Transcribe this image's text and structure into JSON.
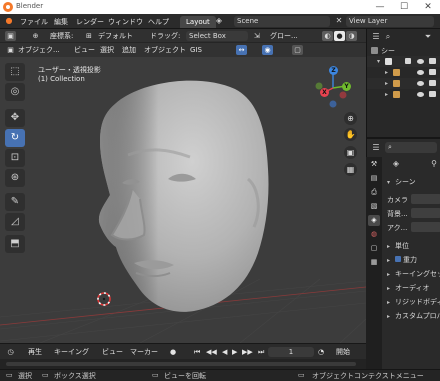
{
  "window": {
    "title": "Blender",
    "minimize": "—",
    "maximize": "☐",
    "close": "✕"
  },
  "topbar": {
    "menu": [
      "ファイル",
      "編集",
      "レンダー",
      "ウィンドウ",
      "ヘルプ"
    ],
    "workspace_tab": "Layout",
    "scene_label": "Scene",
    "view_layer_label": "View Layer"
  },
  "tool_header": {
    "orientation_label": "座標系:",
    "orientation_value": "デフォルト",
    "drag_label": "ドラッグ:",
    "drag_value": "Select Box",
    "transform_value": "グロー..."
  },
  "viewport_header": {
    "mode": "オブジェク...",
    "menus": [
      "ビュー",
      "選択",
      "追加",
      "オブジェクト"
    ],
    "gis": "GIS"
  },
  "viewport": {
    "view_name": "ユーザー・透視投影",
    "collection": "(1) Collection",
    "gizmo": {
      "z": "Z",
      "y": "Y",
      "x": "X"
    }
  },
  "toolbar": {
    "tools": [
      "select-box",
      "cursor",
      "move",
      "rotate",
      "scale",
      "transform",
      "annotate",
      "measure",
      "add-cube"
    ],
    "active": "rotate"
  },
  "outliner": {
    "header_label": "シー",
    "rows": 4
  },
  "properties": {
    "search_placeholder": "",
    "section_scene": "シーン",
    "camera_label": "カメラ",
    "background_label": "背景...",
    "active_clip_label": "アク...",
    "panels": [
      "単位",
      "重力",
      "キーイングセッ",
      "オーディオ",
      "リジッドボディ",
      "カスタムプロパ"
    ],
    "gravity_checked": true
  },
  "timeline": {
    "playback": "再生",
    "keying": "キーイング",
    "view": "ビュー",
    "marker": "マーカー",
    "frame": "1",
    "start": "開始"
  },
  "statusbar": {
    "select": "選択",
    "box_select": "ボックス選択",
    "rotate_view": "ビューを回転",
    "context_menu": "オブジェクトコンテクストメニュー"
  },
  "colors": {
    "accent": "#4772b3",
    "viewport_bg": "#3c3c3c",
    "gizmo_x": "#e8424f",
    "gizmo_y": "#6fba2d",
    "gizmo_z": "#3c86e0"
  }
}
